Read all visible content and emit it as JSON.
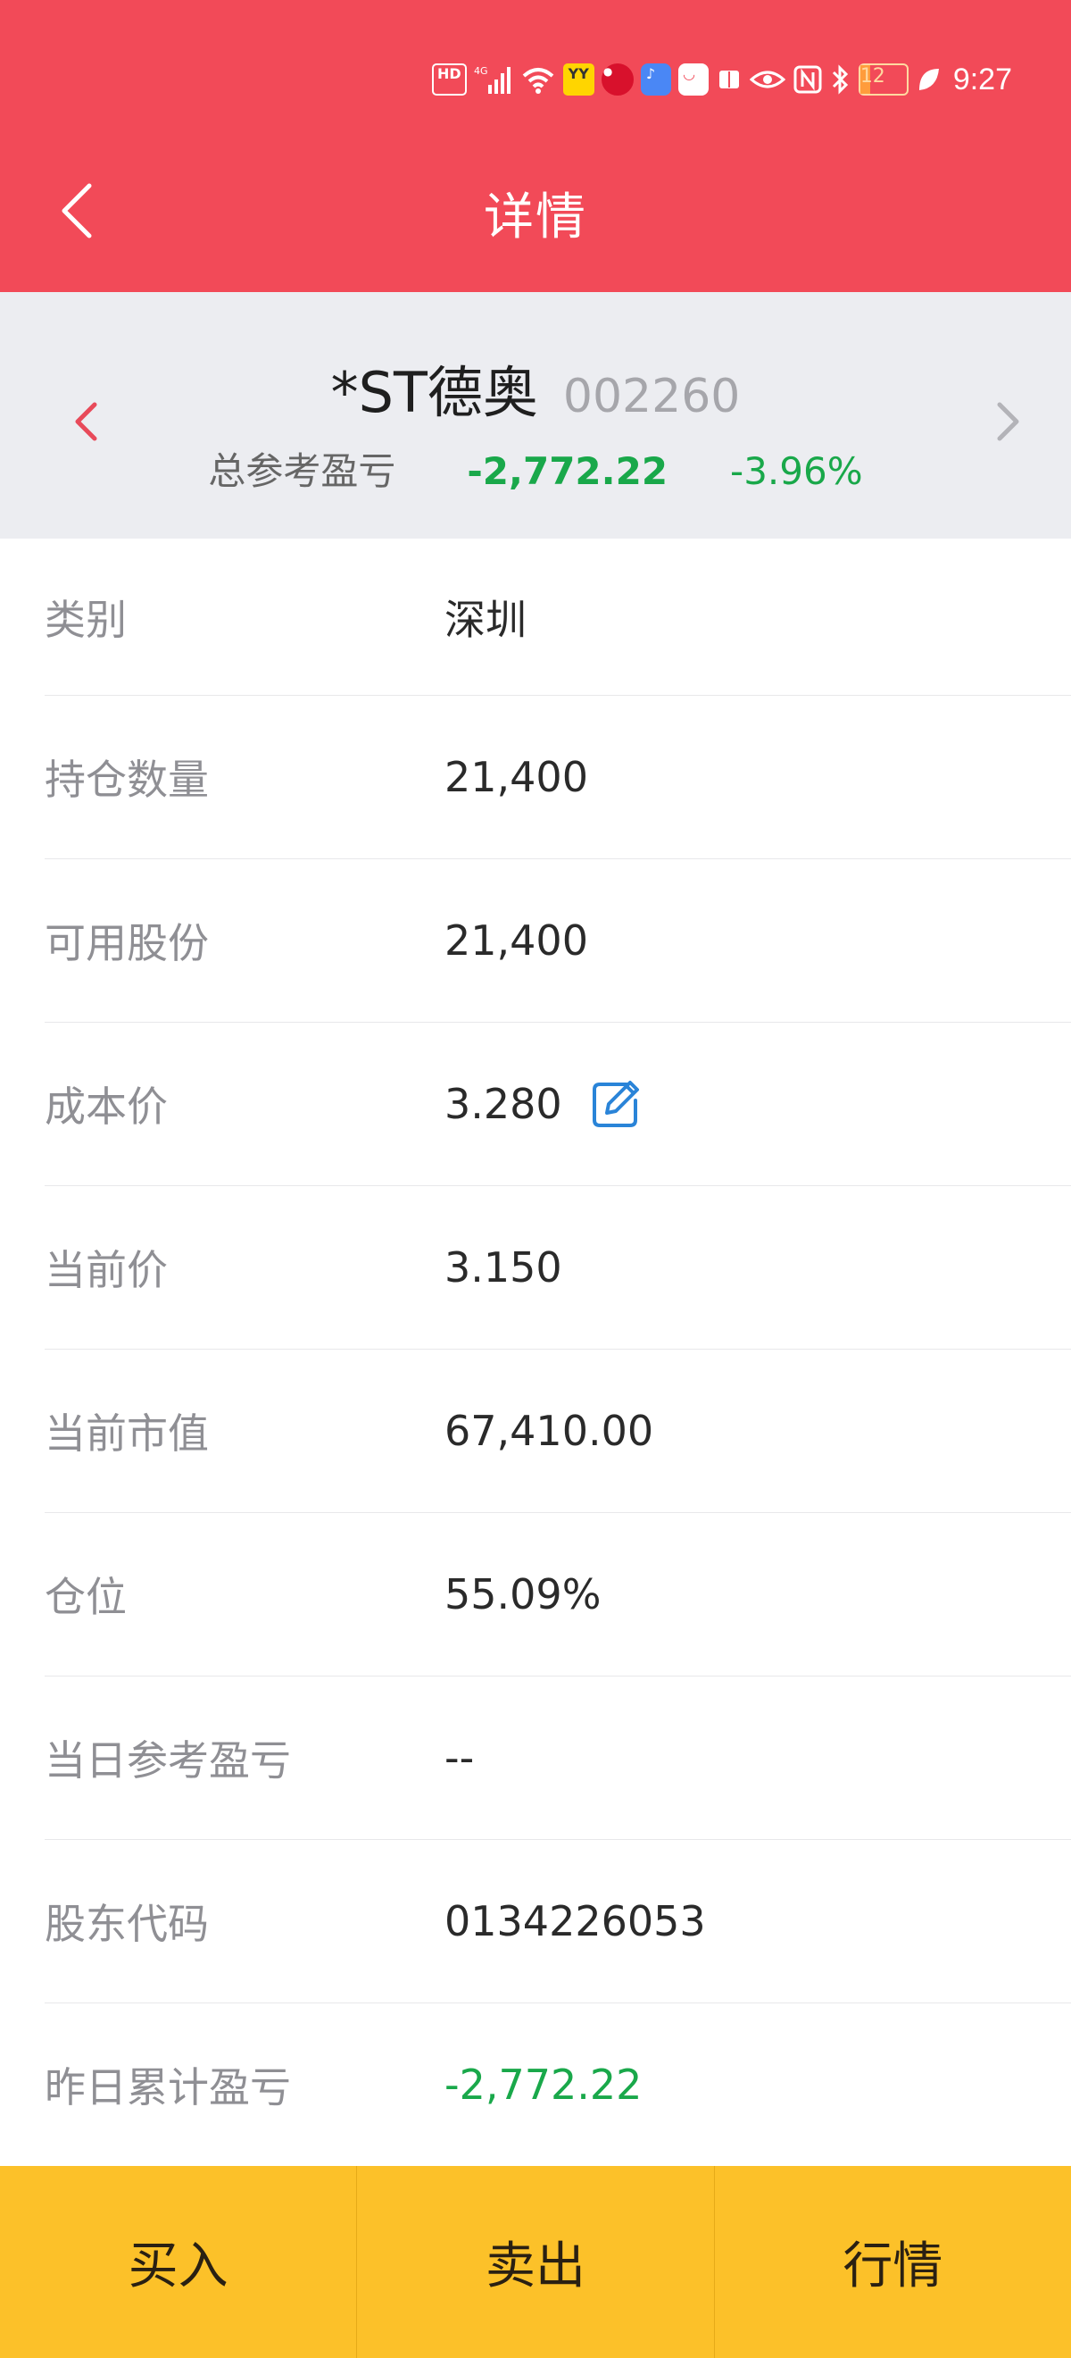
{
  "status_bar": {
    "time": "9:27",
    "battery": "12",
    "icons": [
      "hd-icon",
      "signal-4g-icon",
      "wifi-icon",
      "yy-app-icon",
      "tmall-app-icon",
      "music-app-icon",
      "store-app-icon",
      "book-icon",
      "eye-icon",
      "nfc-icon",
      "bluetooth-icon",
      "battery-icon",
      "leaf-icon"
    ],
    "hd_label": "HD",
    "yy_label": "YY"
  },
  "header": {
    "title": "详情"
  },
  "stock": {
    "name": "*ST德奥",
    "code": "002260",
    "total_pl_label": "总参考盈亏",
    "total_pl_value": "-2,772.22",
    "total_pl_pct": "-3.96%"
  },
  "details": {
    "category": {
      "label": "类别",
      "value": "深圳"
    },
    "holding": {
      "label": "持仓数量",
      "value": "21,400"
    },
    "available": {
      "label": "可用股份",
      "value": "21,400"
    },
    "cost": {
      "label": "成本价",
      "value": "3.280"
    },
    "price": {
      "label": "当前价",
      "value": "3.150"
    },
    "market_value": {
      "label": "当前市值",
      "value": "67,410.00"
    },
    "position": {
      "label": "仓位",
      "value": "55.09%"
    },
    "daily_pl": {
      "label": "当日参考盈亏",
      "value": "--"
    },
    "holder_code": {
      "label": "股东代码",
      "value": "0134226053"
    },
    "yesterday_pl": {
      "label": "昨日累计盈亏",
      "value": "-2,772.22"
    }
  },
  "actions": {
    "buy": "买入",
    "sell": "卖出",
    "quote": "行情"
  },
  "colors": {
    "header": "#f24a58",
    "summary_bg": "#ecedf1",
    "loss_green": "#19a84a",
    "action_bar": "#fcc129",
    "edit_blue": "#2a84d8"
  }
}
